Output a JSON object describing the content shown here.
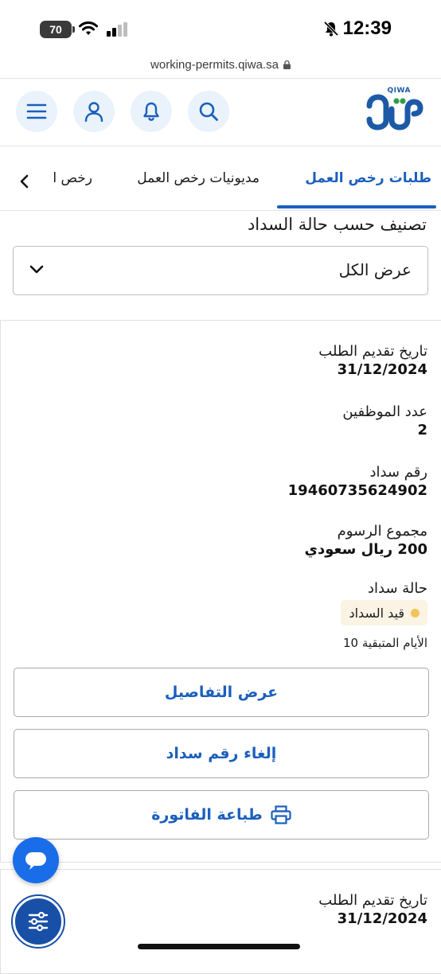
{
  "status_bar": {
    "time": "12:39",
    "battery": "70"
  },
  "browser": {
    "url": "working-permits.qiwa.sa"
  },
  "header": {
    "logo_text": "QIWA"
  },
  "tabs": [
    {
      "label": "طلبات رخص العمل",
      "active": true
    },
    {
      "label": "مديونيات رخص العمل",
      "active": false
    },
    {
      "label": "رخص ا",
      "active": false
    }
  ],
  "filter": {
    "label": "تصنيف حسب حالة السداد",
    "selected": "عرض الكل"
  },
  "card": {
    "submission_date_label": "تاريخ تقديم الطلب",
    "submission_date": "31/12/2024",
    "employees_label": "عدد الموظفين",
    "employees": "2",
    "payment_number_label": "رقم سداد",
    "payment_number": "19460735624902",
    "total_fees_label": "مجموع الرسوم",
    "total_fees": "200 ريال سعودي",
    "payment_status_label": "حالة سداد",
    "payment_status": "قيد السداد",
    "remaining_days": "الأيام المتبقية 10",
    "buttons": {
      "view_details": "عرض التفاصيل",
      "cancel_payment": "إلغاء رقم سداد",
      "print_invoice": "طباعة الفاتورة"
    }
  },
  "card2": {
    "submission_date_label": "تاريخ تقديم الطلب",
    "submission_date": "31/12/2024"
  },
  "colors": {
    "primary": "#1b5fbd",
    "status_dot": "#f2c55a",
    "badge_bg": "#fbf3e4",
    "chat_fab": "#1a6de8"
  }
}
